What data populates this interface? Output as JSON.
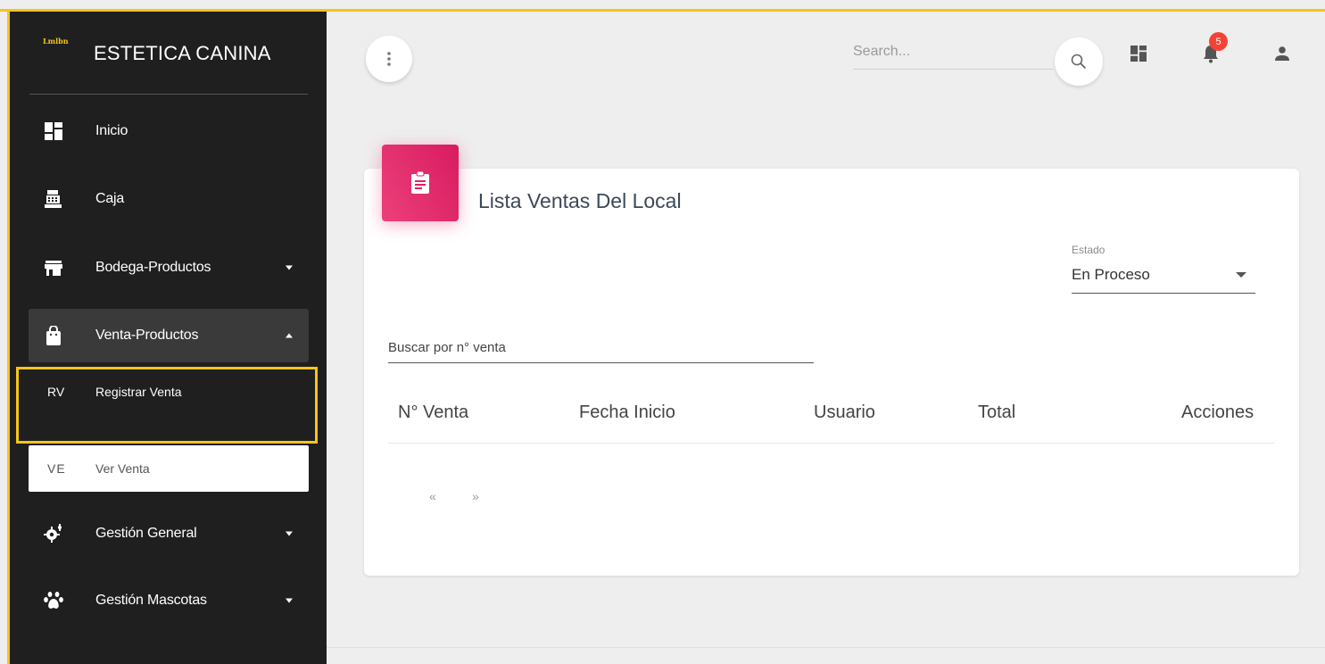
{
  "brand": {
    "logo_text": "Lmlbn",
    "title": "ESTETICA CANINA"
  },
  "sidebar": {
    "items": [
      {
        "label": "Inicio",
        "icon": "dashboard-icon"
      },
      {
        "label": "Caja",
        "icon": "cash-register-icon"
      },
      {
        "label": "Bodega-Productos",
        "icon": "store-icon"
      },
      {
        "label": "Venta-Productos",
        "icon": "shopping-bag-icon"
      },
      {
        "label": "Gestión General",
        "icon": "settings-icon"
      },
      {
        "label": "Gestión Mascotas",
        "icon": "paw-icon"
      }
    ],
    "subitems": [
      {
        "abbr": "RV",
        "label": "Registrar Venta"
      },
      {
        "abbr": "VE",
        "label": "Ver Venta"
      }
    ]
  },
  "topbar": {
    "search_placeholder": "Search...",
    "notification_count": "5"
  },
  "card": {
    "title": "Lista Ventas Del Local",
    "estado_label": "Estado",
    "estado_value": "En Proceso",
    "buscar_placeholder": "Buscar por n° venta",
    "columns": [
      "N° Venta",
      "Fecha Inicio",
      "Usuario",
      "Total",
      "Acciones"
    ],
    "pager_prev": "«",
    "pager_next": "»"
  },
  "colors": {
    "accent_pink": "#e91e63",
    "highlight_yellow": "#f5c518",
    "sidebar_bg": "#1f1f1f",
    "badge_red": "#f44336"
  }
}
